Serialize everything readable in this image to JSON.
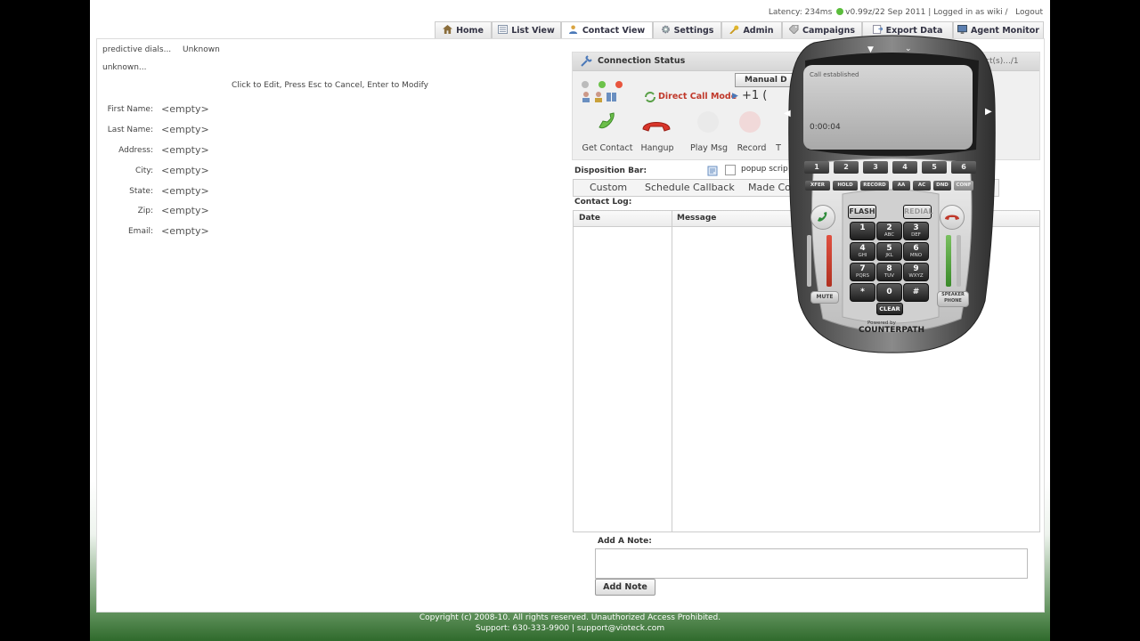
{
  "header": {
    "latency": "Latency: 234ms",
    "version": "v0.99z/22 Sep 2011",
    "logged_in": "| Logged in as wiki /",
    "logout": "Logout"
  },
  "tabs": [
    {
      "label": "Home",
      "icon": "home-icon"
    },
    {
      "label": "List View",
      "icon": "list-icon"
    },
    {
      "label": "Contact View",
      "icon": "contact-icon",
      "active": true
    },
    {
      "label": "Settings",
      "icon": "gear-icon"
    },
    {
      "label": "Admin",
      "icon": "key-icon"
    },
    {
      "label": "Campaigns",
      "icon": "tag-icon"
    },
    {
      "label": "Export Data",
      "icon": "export-icon"
    },
    {
      "label": "Agent Monitor",
      "icon": "monitor-icon"
    }
  ],
  "contact": {
    "dialer": "predictive dials...",
    "dialer_status": "Unknown",
    "subtitle": "unknown...",
    "edit_hint": "Click to Edit, Press Esc to Cancel, Enter to Modify",
    "fields": [
      {
        "label": "First Name:",
        "value": "<empty>"
      },
      {
        "label": "Last Name:",
        "value": "<empty>"
      },
      {
        "label": "Address:",
        "value": "<empty>"
      },
      {
        "label": "City:",
        "value": "<empty>"
      },
      {
        "label": "State:",
        "value": "<empty>"
      },
      {
        "label": "Zip:",
        "value": "<empty>"
      },
      {
        "label": "Email:",
        "value": "<empty>"
      }
    ]
  },
  "connection": {
    "title": "Connection Status",
    "contacts_count": "tact(s).../1",
    "manual_label": "Manual D",
    "direct_call": "Direct Call Mode",
    "number_prefix": "+1 (",
    "buttons": {
      "get_contact": "Get Contact",
      "hangup": "Hangup",
      "play_msg": "Play Msg",
      "record": "Record",
      "truncated": "T"
    }
  },
  "disposition": {
    "label": "Disposition Bar:",
    "popup": "popup scrip",
    "tail": "ll",
    "tabs": [
      "Custom",
      "Schedule Callback",
      "Made Co"
    ]
  },
  "contact_log": {
    "label": "Contact Log:",
    "columns": [
      "Date",
      "Message"
    ]
  },
  "note": {
    "label": "Add A Note:",
    "button": "Add Note"
  },
  "footer": {
    "copyright": "Copyright (c) 2008-10. All rights reserved. Unauthorized Access Prohibited.",
    "support": "Support: 630-333-9900 | support@vioteck.com"
  },
  "phone": {
    "status": "Call established",
    "timer": "0:00:04",
    "line_keys": [
      "1",
      "2",
      "3",
      "4",
      "5",
      "6"
    ],
    "func_keys": [
      "XFER",
      "HOLD",
      "RECORD",
      "AA",
      "AC",
      "DND",
      "CONF"
    ],
    "flash": "FLASH",
    "redial": "REDIAL",
    "keys": [
      {
        "d": "1",
        "s": ""
      },
      {
        "d": "2",
        "s": "ABC"
      },
      {
        "d": "3",
        "s": "DEF"
      },
      {
        "d": "4",
        "s": "GHI"
      },
      {
        "d": "5",
        "s": "JKL"
      },
      {
        "d": "6",
        "s": "MNO"
      },
      {
        "d": "7",
        "s": "PQRS"
      },
      {
        "d": "8",
        "s": "TUV"
      },
      {
        "d": "9",
        "s": "WXYZ"
      },
      {
        "d": "*",
        "s": ""
      },
      {
        "d": "0",
        "s": ""
      },
      {
        "d": "#",
        "s": ""
      }
    ],
    "clear": "CLEAR",
    "mute": "MUTE",
    "speaker": "SPEAKER PHONE",
    "powered": "Powered by",
    "brand": "COUNTERPATH"
  }
}
